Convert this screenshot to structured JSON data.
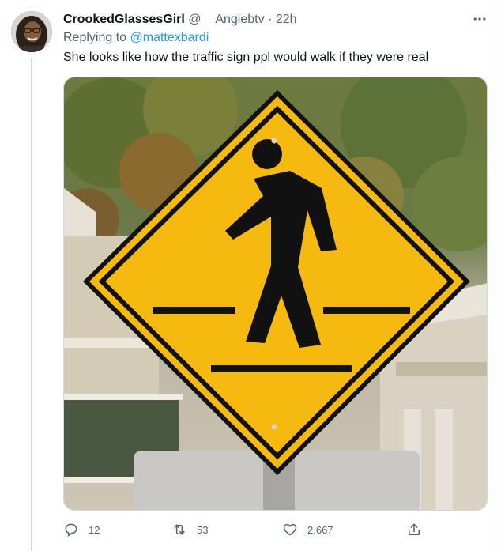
{
  "tweet": {
    "display_name": "CrookedGlassesGirl",
    "handle": "@__Angiebtv",
    "separator": "·",
    "time": "22h",
    "replying_prefix": "Replying to",
    "replying_to": "@mattexbardi",
    "text": "She looks like how the traffic sign ppl would walk if they were real"
  },
  "actions": {
    "replies": "12",
    "retweets": "53",
    "likes": "2,667"
  },
  "icons": {
    "more": "more-icon",
    "reply": "reply-icon",
    "retweet": "retweet-icon",
    "like": "heart-icon",
    "share": "share-icon"
  },
  "colors": {
    "accent": "#1d9bf0",
    "muted": "#536471",
    "sign_yellow": "#f5b90f"
  }
}
